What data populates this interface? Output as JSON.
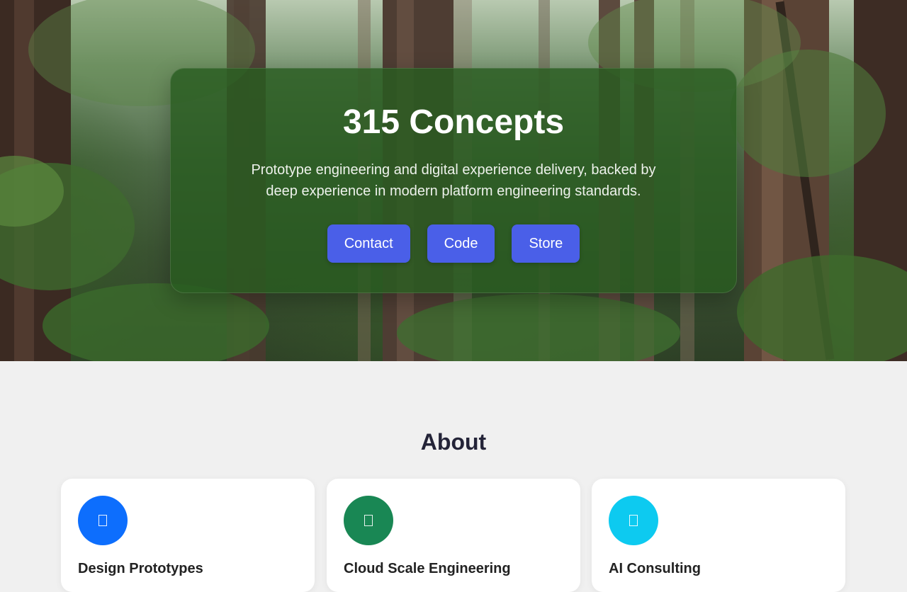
{
  "hero": {
    "title": "315 Concepts",
    "subtitle": "Prototype engineering and digital experience delivery, backed by deep experience in modern platform engineering standards.",
    "buttons": [
      {
        "label": "Contact"
      },
      {
        "label": "Code"
      },
      {
        "label": "Store"
      }
    ],
    "button_color": "#4a5fe8"
  },
  "about": {
    "title": "About",
    "cards": [
      {
        "title": "Design Prototypes",
        "icon": "prototype-icon",
        "color": "#0d6efd"
      },
      {
        "title": "Cloud Scale Engineering",
        "icon": "cloud-icon",
        "color": "#198754"
      },
      {
        "title": "AI Consulting",
        "icon": "ai-icon",
        "color": "#0dcaf0"
      }
    ]
  }
}
